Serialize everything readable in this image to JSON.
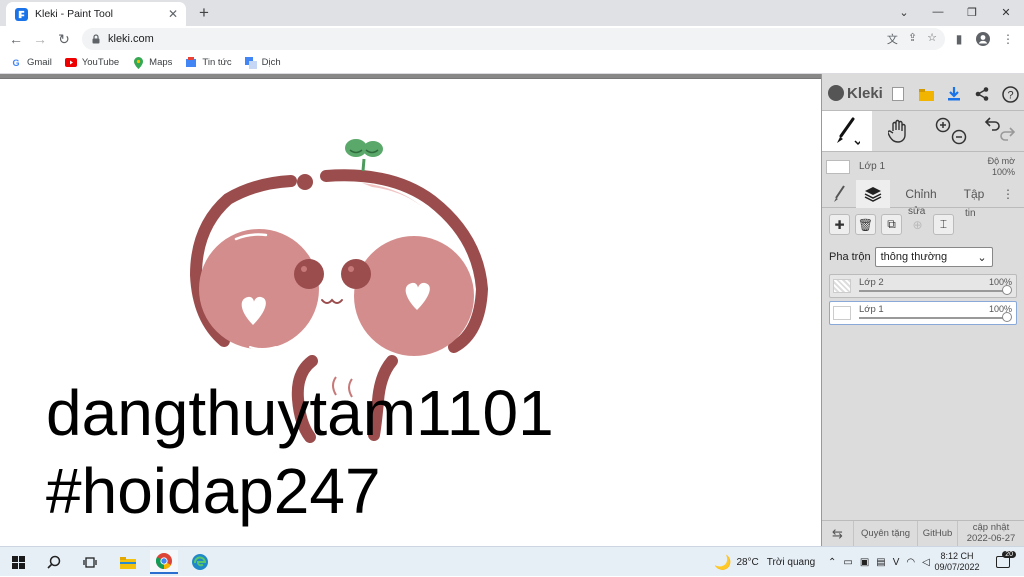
{
  "browser": {
    "tab_title": "Kleki - Paint Tool",
    "url": "kleki.com",
    "bookmarks": [
      {
        "label": "Gmail",
        "icon": "google-icon"
      },
      {
        "label": "YouTube",
        "icon": "youtube-icon"
      },
      {
        "label": "Maps",
        "icon": "maps-icon"
      },
      {
        "label": "Tin tức",
        "icon": "news-icon"
      },
      {
        "label": "Dịch",
        "icon": "translate-icon"
      }
    ]
  },
  "canvas": {
    "line1": "dangthuytam1101",
    "line2": "#hoidap247",
    "colors": {
      "outline": "#9b4d4d",
      "cheek": "#d48d8d",
      "leaf": "#5aa86a"
    }
  },
  "kleki": {
    "logo": "Kleki",
    "current_layer": "Lớp 1",
    "opacity_label": "Độ mờ",
    "opacity_value": "100%",
    "tabs": {
      "adjust": "Chỉnh",
      "file": "Tập"
    },
    "button_labels": {
      "edit": "sửa",
      "info": "tin"
    },
    "blend_label": "Pha trộn",
    "blend_value": "thông thường",
    "layers": [
      {
        "name": "Lớp 2",
        "opacity": "100%",
        "selected": false
      },
      {
        "name": "Lớp 1",
        "opacity": "100%",
        "selected": true
      }
    ],
    "footer": {
      "donate": "Quyên tặng",
      "github": "GitHub",
      "update_line1": "cập nhật",
      "update_line2": "2022-06-27"
    }
  },
  "taskbar": {
    "temperature": "28°C",
    "weather": "Trời quang",
    "time": "8:12 CH",
    "date": "09/07/2022",
    "notification_count": "20"
  }
}
